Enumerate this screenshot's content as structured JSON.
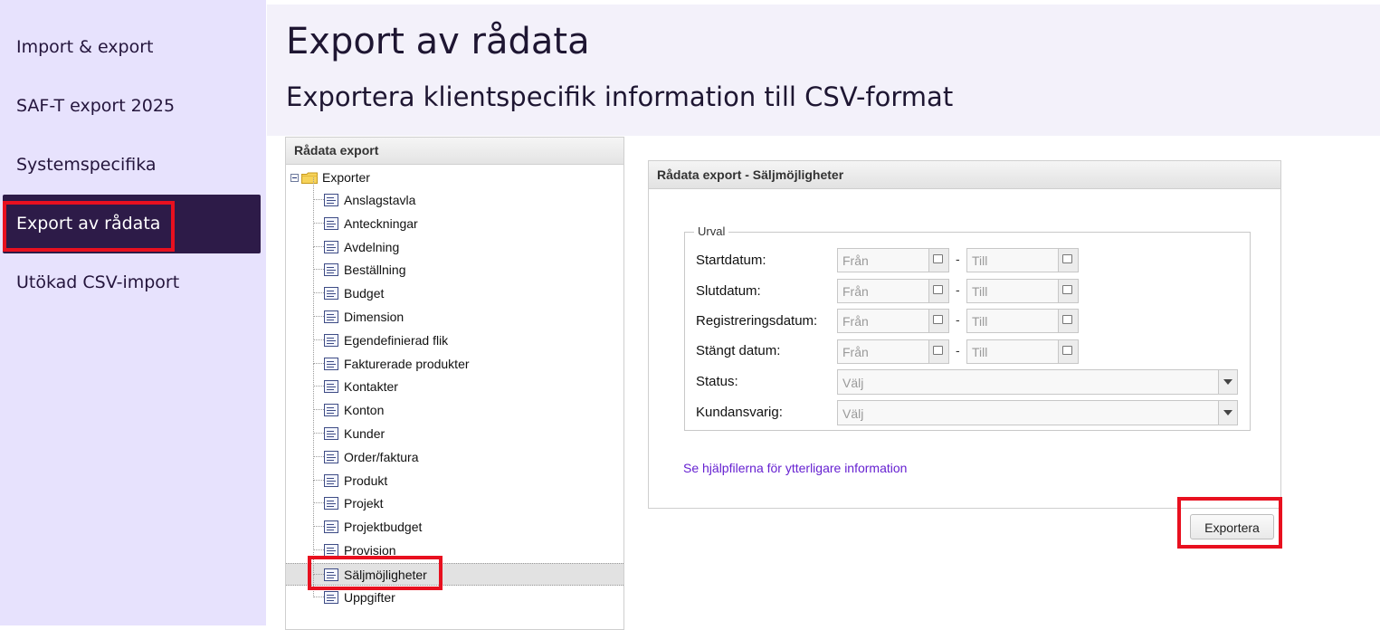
{
  "sidebar": {
    "items": [
      {
        "label": "Import & export",
        "active": false
      },
      {
        "label": "SAF-T export 2025",
        "active": false
      },
      {
        "label": "Systemspecifika",
        "active": false
      },
      {
        "label": "Export av rådata",
        "active": true
      },
      {
        "label": "Utökad CSV-import",
        "active": false
      }
    ]
  },
  "header": {
    "title": "Export av rådata",
    "subtitle": "Exportera klientspecifik information till CSV-format"
  },
  "tree": {
    "panel_title": "Rådata export",
    "root_label": "Exporter",
    "root_icons": [
      "minus-expander-icon",
      "folder-icon"
    ],
    "item_icon": "document-list-icon",
    "items": [
      "Anslagstavla",
      "Anteckningar",
      "Avdelning",
      "Beställning",
      "Budget",
      "Dimension",
      "Egendefinierad flik",
      "Fakturerade produkter",
      "Kontakter",
      "Konton",
      "Kunder",
      "Order/faktura",
      "Produkt",
      "Projekt",
      "Projektbudget",
      "Provision",
      "Säljmöjligheter",
      "Uppgifter"
    ],
    "selected": "Säljmöjligheter"
  },
  "export_panel": {
    "title": "Rådata export - Säljmöjligheter",
    "fieldset_legend": "Urval",
    "date_rows": [
      {
        "label": "Startdatum:",
        "from_placeholder": "Från",
        "to_placeholder": "Till"
      },
      {
        "label": "Slutdatum:",
        "from_placeholder": "Från",
        "to_placeholder": "Till"
      },
      {
        "label": "Registreringsdatum:",
        "from_placeholder": "Från",
        "to_placeholder": "Till"
      },
      {
        "label": "Stängt datum:",
        "from_placeholder": "Från",
        "to_placeholder": "Till"
      }
    ],
    "separator": "-",
    "status": {
      "label": "Status:",
      "value": "Välj"
    },
    "kundansvarig": {
      "label": "Kundansvarig:",
      "value": "Välj"
    },
    "help_link": "Se hjälpfilerna för ytterligare information",
    "export_button": "Exportera"
  },
  "colors": {
    "sidebar_bg": "#e7e2fd",
    "sidebar_active_bg": "#2d1b48",
    "highlight": "#e8101f",
    "link": "#6621d1"
  }
}
